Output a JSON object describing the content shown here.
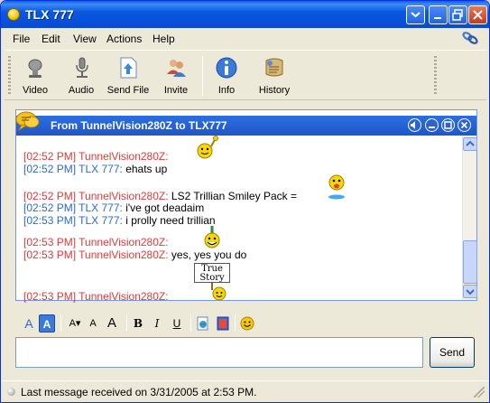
{
  "window": {
    "title": "TLX 777"
  },
  "menu": [
    "File",
    "Edit",
    "View",
    "Actions",
    "Help"
  ],
  "toolbar": [
    {
      "label": "Video",
      "icon": "video-icon"
    },
    {
      "label": "Audio",
      "icon": "audio-icon"
    },
    {
      "label": "Send File",
      "icon": "send-file-icon"
    },
    {
      "label": "Invite",
      "icon": "invite-icon"
    },
    {
      "label": "Info",
      "icon": "info-icon"
    },
    {
      "label": "History",
      "icon": "history-icon"
    }
  ],
  "conversation": {
    "header_title": "From TunnelVision280Z to TLX777",
    "messages": [
      {
        "time": "[02:52 PM]",
        "nick": "TunnelVision280Z:",
        "text": "",
        "side": "remote",
        "emoticon": "wave-smiley"
      },
      {
        "time": "[02:52 PM]",
        "nick": "TLX 777:",
        "text": "ehats up",
        "side": "local"
      },
      {
        "time": "[02:52 PM]",
        "nick": "TunnelVision280Z:",
        "text": "LS2 Trillian Smiley Pack =",
        "side": "remote",
        "emoticon": "tongue-smiley"
      },
      {
        "time": "[02:52 PM]",
        "nick": "TLX 777:",
        "text": "i've got deadaim",
        "side": "local"
      },
      {
        "time": "[02:53 PM]",
        "nick": "TLX 777:",
        "text": "i prolly need trillian",
        "side": "local"
      },
      {
        "time": "[02:53 PM]",
        "nick": "TunnelVision280Z:",
        "text": "",
        "side": "remote",
        "emoticon": "pointing-smiley"
      },
      {
        "time": "[02:53 PM]",
        "nick": "TunnelVision280Z:",
        "text": "yes, yes you do",
        "side": "remote"
      },
      {
        "time": "[02:53 PM]",
        "nick": "TunnelVision280Z:",
        "text": "",
        "side": "remote",
        "emoticon": "true-story-sign"
      }
    ],
    "sign_text": [
      "True",
      "Story"
    ]
  },
  "format_toolbar": [
    "A",
    "A",
    "A▾",
    "A",
    "A",
    "B",
    "I",
    "U"
  ],
  "input": {
    "value": "",
    "placeholder": ""
  },
  "send_label": "Send",
  "status": {
    "text": "Last message received on 3/31/2005 at 2:53 PM."
  },
  "colors": {
    "remote": "#e23a3a",
    "local": "#2a6ad8",
    "titlebar": "#0a58e0",
    "panel_header": "#2d6fe0"
  }
}
